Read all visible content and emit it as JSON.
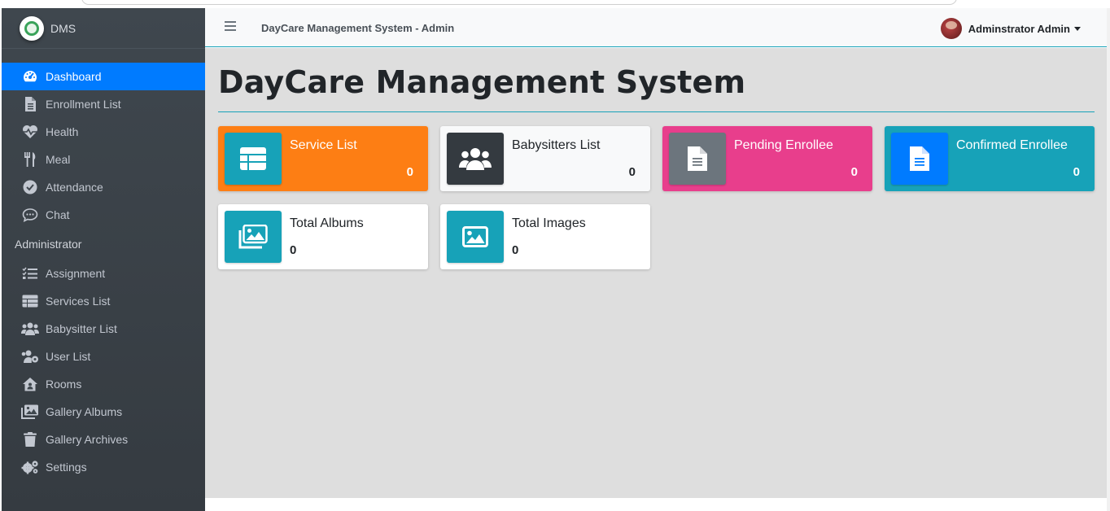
{
  "brand": {
    "name": "DMS"
  },
  "navbar": {
    "title": "DayCare Management System - Admin",
    "user_name": "Adminstrator Admin"
  },
  "sidebar": {
    "items": [
      {
        "label": "Dashboard",
        "icon": "tachometer-icon",
        "active": true
      },
      {
        "label": "Enrollment List",
        "icon": "file-icon"
      },
      {
        "label": "Health",
        "icon": "heartbeat-icon"
      },
      {
        "label": "Meal",
        "icon": "utensils-icon"
      },
      {
        "label": "Attendance",
        "icon": "check-circle-icon"
      },
      {
        "label": "Chat",
        "icon": "comment-icon"
      }
    ],
    "header": "Administrator",
    "admin_items": [
      {
        "label": "Assignment",
        "icon": "tasks-icon"
      },
      {
        "label": "Services List",
        "icon": "table-icon"
      },
      {
        "label": "Babysitter List",
        "icon": "users-icon"
      },
      {
        "label": "User List",
        "icon": "users-cog-icon"
      },
      {
        "label": "Rooms",
        "icon": "house-user-icon"
      },
      {
        "label": "Gallery Albums",
        "icon": "images-icon"
      },
      {
        "label": "Gallery Archives",
        "icon": "trash-icon"
      },
      {
        "label": "Settings",
        "icon": "cogs-icon"
      }
    ]
  },
  "main": {
    "title": "DayCare Management System",
    "cards": [
      {
        "label": "Service List",
        "value": "0",
        "bg": "#fd7e14",
        "icon_bg": "#17a2b8",
        "icon": "table-icon"
      },
      {
        "label": "Babysitters List",
        "value": "0",
        "bg": "#f8f9fa",
        "icon_bg": "#343a40",
        "icon": "users-icon"
      },
      {
        "label": "Pending Enrollee",
        "value": "0",
        "bg": "#e83e8c",
        "icon_bg": "#6c757d",
        "icon": "file-alt-icon"
      },
      {
        "label": "Confirmed Enrollee",
        "value": "0",
        "bg": "#17a2b8",
        "icon_bg": "#007bff",
        "icon": "file-alt-icon"
      },
      {
        "label": "Total Albums",
        "value": "0",
        "bg": "#ffffff",
        "icon_bg": "#17a2b8",
        "icon": "images-icon"
      },
      {
        "label": "Total Images",
        "value": "0",
        "bg": "#ffffff",
        "icon_bg": "#17a2b8",
        "icon": "image-icon"
      }
    ]
  }
}
